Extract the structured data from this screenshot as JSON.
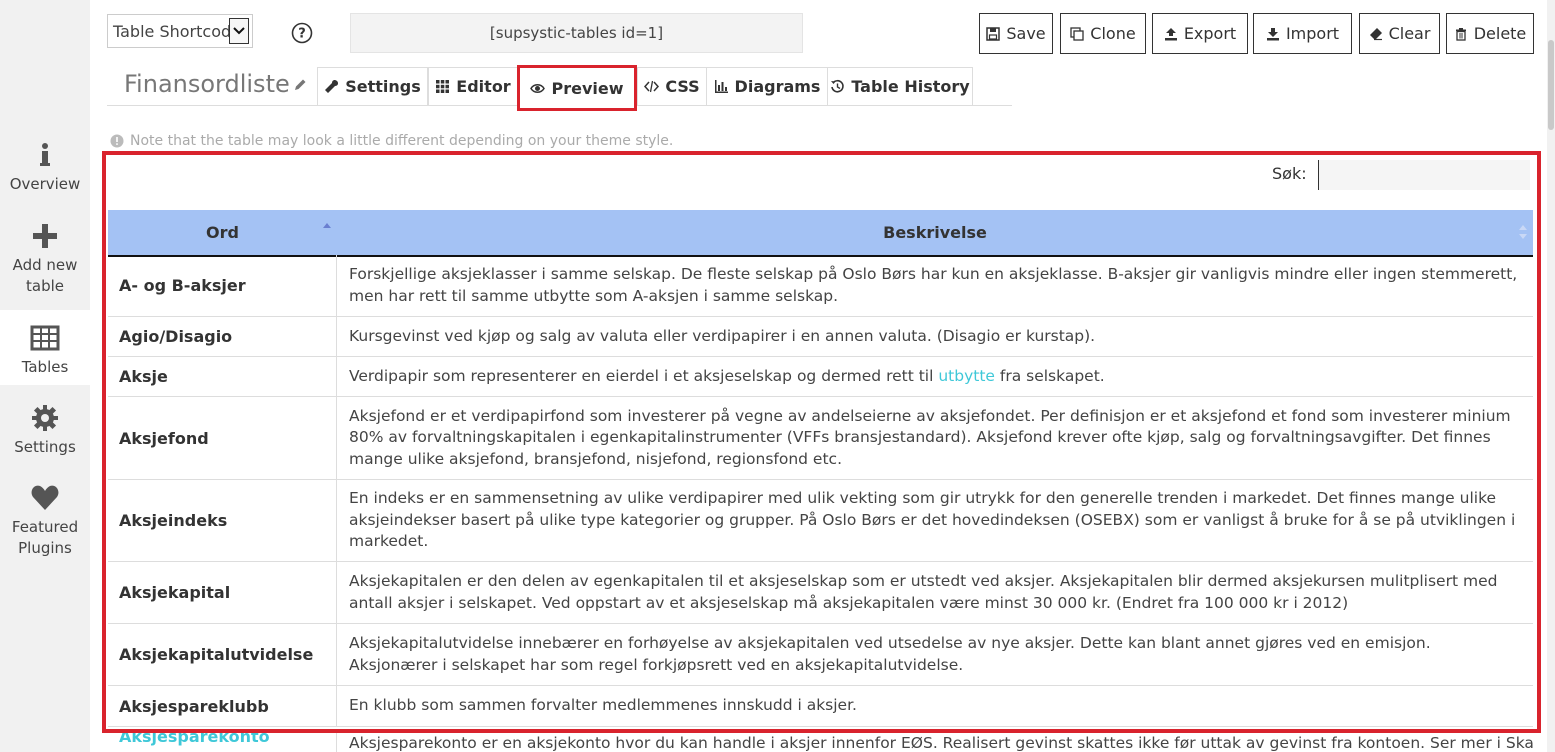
{
  "sidebar": {
    "items": [
      {
        "label_lines": [
          "Overview"
        ],
        "icon": "info-icon"
      },
      {
        "label_lines": [
          "Add new",
          "table"
        ],
        "icon": "plus-icon"
      },
      {
        "label_lines": [
          "Tables"
        ],
        "icon": "table-grid-icon"
      },
      {
        "label_lines": [
          "Settings"
        ],
        "icon": "gear-icon"
      },
      {
        "label_lines": [
          "Featured",
          "Plugins"
        ],
        "icon": "heart-icon"
      }
    ]
  },
  "toolbar": {
    "shortcode_select_value": "Table Shortcode",
    "shortcode": "[supsystic-tables id=1]",
    "buttons": {
      "save": "Save",
      "clone": "Clone",
      "export": "Export",
      "import": "Import",
      "clear": "Clear",
      "delete": "Delete"
    }
  },
  "table_title": "Finansordliste",
  "tabs": {
    "settings": "Settings",
    "editor": "Editor",
    "preview": "Preview",
    "css": "CSS",
    "diagrams": "Diagrams",
    "history": "Table History"
  },
  "note": "Note that the table may look a little different depending on your theme style.",
  "search": {
    "label": "Søk:",
    "value": ""
  },
  "columns": {
    "word": "Ord",
    "description": "Beskrivelse"
  },
  "rows": [
    {
      "word": "A- og B-aksjer",
      "desc": "Forskjellige aksjeklasser i samme selskap. De fleste selskap på Oslo Børs har kun en aksjeklasse. B-aksjer gir vanligvis mindre eller ingen stemmerett, men har rett til samme utbytte som A-aksjen i samme selskap."
    },
    {
      "word": "Agio/Disagio",
      "desc": "Kursgevinst ved kjøp og salg av valuta eller verdipapirer i en annen valuta. (Disagio er kurstap)."
    },
    {
      "word": "Aksje",
      "desc_before": "Verdipapir som representerer en eierdel i et aksjeselskap og dermed rett til ",
      "desc_link": "utbytte",
      "desc_after": " fra selskapet."
    },
    {
      "word": "Aksjefond",
      "desc": "Aksjefond er et verdipapirfond som investerer på vegne av andelseierne av aksjefondet. Per definisjon er et aksjefond et fond som investerer minium 80% av forvaltningskapitalen i egenkapitalinstrumenter (VFFs bransjestandard). Aksjefond krever ofte kjøp, salg og forvaltningsavgifter. Det finnes mange ulike aksjefond, bransjefond, nisjefond, regionsfond etc."
    },
    {
      "word": "Aksjeindeks",
      "desc": "En indeks er en sammensetning av ulike verdipapirer med ulik vekting som gir utrykk for den generelle trenden i markedet. Det finnes mange ulike aksjeindekser basert på ulike type kategorier og grupper. På Oslo Børs er det hovedindeksen (OSEBX) som er vanligst å bruke for å se på utviklingen i markedet."
    },
    {
      "word": "Aksjekapital",
      "desc": "Aksjekapitalen er den delen av egenkapitalen til et aksjeselskap som er utstedt ved aksjer. Aksjekapitalen blir dermed aksjekursen mulitplisert med antall aksjer i selskapet. Ved oppstart av et aksjeselskap må aksjekapitalen være minst 30 000 kr. (Endret fra 100 000 kr i 2012)"
    },
    {
      "word": "Aksjekapitalutvidelse",
      "desc": "Aksjekapitalutvidelse innebærer en forhøyelse av aksjekapitalen ved utsedelse av nye aksjer. Dette kan blant annet gjøres ved en emisjon. Aksjonærer i selskapet har som regel forkjøpsrett ved en aksjekapitalutvidelse."
    },
    {
      "word": "Aksjespareklubb",
      "desc": "En klubb som sammen forvalter medlemmenes innskudd i aksjer."
    },
    {
      "word": "Aksjesparekonto",
      "desc": "Aksjesparekonto er en aksjekonto hvor du kan handle i aksjer innenfor EØS. Realisert gevinst skattes ikke før uttak av gevinst fra kontoen. Ser mer i Skatt"
    }
  ]
}
